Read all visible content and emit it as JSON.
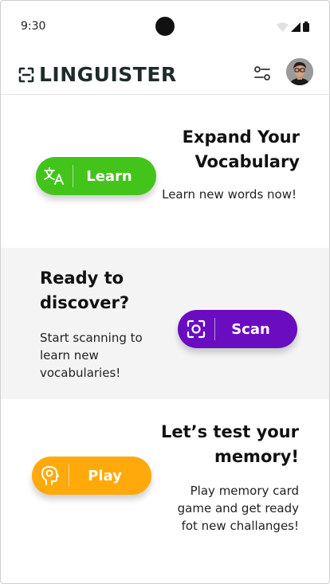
{
  "status": {
    "time": "9:30"
  },
  "app": {
    "title": "LINGUISTER",
    "icons": {
      "logo": "scan-logo-icon",
      "filter": "filter-sliders-icon",
      "profile": "avatar"
    }
  },
  "sections": [
    {
      "heading": "Expand Your Vocabulary",
      "description": "Learn new words now!",
      "button": {
        "label": "Learn",
        "icon": "translate-icon",
        "color": "#43C41A"
      }
    },
    {
      "heading": "Ready to discover?",
      "description": "Start scanning to learn new vocabularies!",
      "button": {
        "label": "Scan",
        "icon": "camera-scan-icon",
        "color": "#6A0DC1"
      }
    },
    {
      "heading": "Let’s test your memory!",
      "description": "Play memory card game and get ready fot new challanges!",
      "button": {
        "label": "Play",
        "icon": "brain-head-icon",
        "color": "#FFA90A"
      }
    }
  ],
  "colors": {
    "section_alt_bg": "#F4F4F4"
  }
}
